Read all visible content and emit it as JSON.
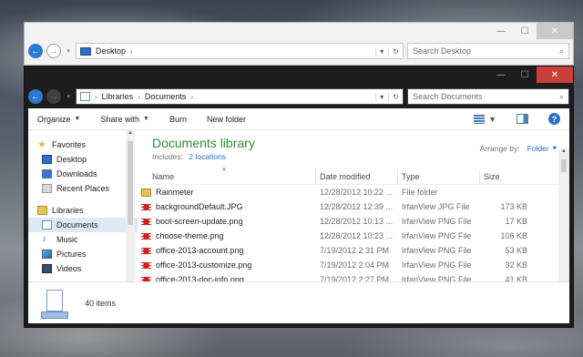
{
  "back_window": {
    "address": "Desktop",
    "search_placeholder": "Search Desktop",
    "caption": {
      "minimize": "—",
      "maximize": "☐",
      "close": "✕"
    }
  },
  "front_window": {
    "breadcrumb": [
      "Libraries",
      "Documents"
    ],
    "search_placeholder": "Search Documents",
    "caption": {
      "minimize": "—",
      "maximize": "☐",
      "close": "✕"
    },
    "commands": {
      "organize": "Organize",
      "share_with": "Share with",
      "burn": "Burn",
      "new_folder": "New folder"
    },
    "nav": {
      "favorites": "Favorites",
      "favorites_items": [
        "Desktop",
        "Downloads",
        "Recent Places"
      ],
      "libraries": "Libraries",
      "libraries_items": [
        "Documents",
        "Music",
        "Pictures",
        "Videos"
      ]
    },
    "library": {
      "title": "Documents library",
      "includes_label": "Includes:",
      "includes_link": "2 locations",
      "arrange_label": "Arrange by:",
      "arrange_value": "Folder"
    },
    "columns": {
      "name": "Name",
      "date": "Date modified",
      "type": "Type",
      "size": "Size"
    },
    "files": [
      {
        "name": "Rainmeter",
        "date": "12/28/2012 10:22 ...",
        "type": "File folder",
        "size": "",
        "icon": "folder-icon"
      },
      {
        "name": "backgroundDefault.JPG",
        "date": "12/28/2012 12:39 ...",
        "type": "IrfanView JPG File",
        "size": "173 KB",
        "icon": "irfanview-icon"
      },
      {
        "name": "boot-screen-update.png",
        "date": "12/28/2012 10:13 ...",
        "type": "IrfanView PNG File",
        "size": "17 KB",
        "icon": "irfanview-icon"
      },
      {
        "name": "choose-theme.png",
        "date": "12/28/2012 10:23 ...",
        "type": "IrfanView PNG File",
        "size": "106 KB",
        "icon": "irfanview-icon"
      },
      {
        "name": "office-2013-account.png",
        "date": "7/19/2012 2:31 PM",
        "type": "IrfanView PNG File",
        "size": "53 KB",
        "icon": "irfanview-icon"
      },
      {
        "name": "office-2013-customize.png",
        "date": "7/19/2012 2:04 PM",
        "type": "IrfanView PNG File",
        "size": "32 KB",
        "icon": "irfanview-icon"
      },
      {
        "name": "office-2013-doc-info.png",
        "date": "7/19/2012 2:27 PM",
        "type": "IrfanView PNG File",
        "size": "41 KB",
        "icon": "irfanview-icon"
      }
    ],
    "status": {
      "items_count": "40 items"
    }
  }
}
